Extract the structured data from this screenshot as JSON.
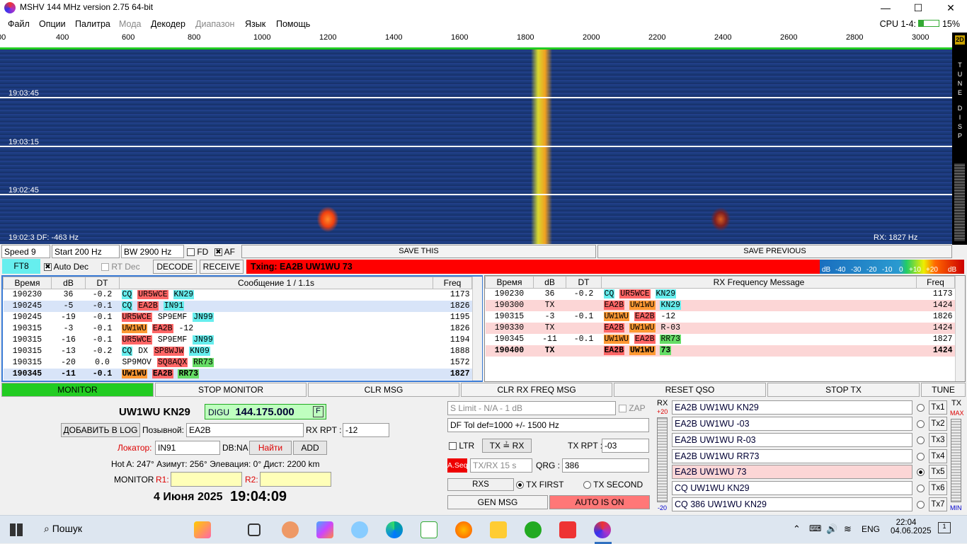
{
  "window": {
    "title": "MSHV 144 MHz version 2.75 64-bit",
    "min": "—",
    "max": "☐",
    "close": "✕"
  },
  "menu": [
    "Файл",
    "Опции",
    "Палитра",
    "Мода",
    "Декодер",
    "Диапазон",
    "Язык",
    "Помощь"
  ],
  "menu_disabled": [
    false,
    false,
    false,
    true,
    false,
    true,
    false,
    false
  ],
  "cpu": {
    "label": "CPU 1-4:",
    "value": "15%"
  },
  "ruler": [
    "00",
    "400",
    "600",
    "800",
    "1000",
    "1200",
    "1400",
    "1600",
    "1800",
    "2000",
    "2200",
    "2400",
    "2600",
    "2800",
    "3000"
  ],
  "waterfall": {
    "times": [
      "19:03:45",
      "19:03:15",
      "19:02:45",
      "19:02:3"
    ],
    "df": "DF: -463 Hz",
    "rx": "RX: 1827 Hz",
    "side": [
      "2D",
      "T",
      "U",
      "N",
      "E",
      "D",
      "I",
      "S",
      "P"
    ]
  },
  "toolbar": {
    "speed": "Speed 9",
    "start": "Start 200 Hz",
    "bw": "BW 2900 Hz",
    "fd": "FD",
    "af": "AF",
    "save_this": "SAVE THIS",
    "save_prev": "SAVE PREVIOUS"
  },
  "mode": {
    "ft8": "FT8",
    "auto_dec": "Auto Dec",
    "rt_dec": "RT Dec",
    "decode": "DECODE",
    "receive": "RECEIVE",
    "txing": "Txing: EA2B UW1WU 73"
  },
  "dbmeter": [
    "dB",
    "-40",
    "-30",
    "-20",
    "-10",
    "0",
    "+10",
    "+20",
    "dB"
  ],
  "left_table": {
    "headers": [
      "Время",
      "dB",
      "DT",
      "Сообщение 1 / 1.1s",
      "Freq"
    ],
    "rows": [
      {
        "t": "190230",
        "db": "36",
        "dt": "-0.2",
        "parts": [
          [
            "CQ",
            "cq"
          ],
          [
            "UR5WCE",
            "red"
          ],
          [
            "KN29",
            "loc"
          ]
        ],
        "f": "1173",
        "cls": ""
      },
      {
        "t": "190245",
        "db": "-5",
        "dt": "-0.1",
        "parts": [
          [
            "CQ",
            "cq"
          ],
          [
            "EA2B",
            "red"
          ],
          [
            "IN91",
            "loc"
          ]
        ],
        "f": "1826",
        "cls": "rowsel"
      },
      {
        "t": "190245",
        "db": "-19",
        "dt": "-0.1",
        "parts": [
          [
            "UR5WCE",
            "red"
          ],
          [
            "SP9EMF",
            ""
          ],
          [
            "JN99",
            "loc"
          ]
        ],
        "f": "1195",
        "cls": ""
      },
      {
        "t": "190315",
        "db": "-3",
        "dt": "-0.1",
        "parts": [
          [
            "UW1WU",
            "me"
          ],
          [
            "EA2B",
            "red"
          ],
          [
            "-12",
            ""
          ]
        ],
        "f": "1826",
        "cls": ""
      },
      {
        "t": "190315",
        "db": "-16",
        "dt": "-0.1",
        "parts": [
          [
            "UR5WCE",
            "red"
          ],
          [
            "SP9EMF",
            ""
          ],
          [
            "JN99",
            "loc"
          ]
        ],
        "f": "1194",
        "cls": ""
      },
      {
        "t": "190315",
        "db": "-13",
        "dt": "-0.2",
        "parts": [
          [
            "CQ",
            "cq"
          ],
          [
            "DX",
            ""
          ],
          [
            "SP8WJW",
            "red"
          ],
          [
            "KN09",
            "loc"
          ]
        ],
        "f": "1888",
        "cls": ""
      },
      {
        "t": "190315",
        "db": "-20",
        "dt": "0.0",
        "parts": [
          [
            "SP9MOV",
            ""
          ],
          [
            "SQ8AQX",
            "red"
          ],
          [
            "RR73",
            "rr"
          ]
        ],
        "f": "1572",
        "cls": ""
      },
      {
        "t": "190345",
        "db": "-11",
        "dt": "-0.1",
        "parts": [
          [
            "UW1WU",
            "me"
          ],
          [
            "EA2B",
            "red"
          ],
          [
            "RR73",
            "rr"
          ]
        ],
        "f": "1827",
        "cls": "rowsel"
      }
    ]
  },
  "right_table": {
    "headers": [
      "Время",
      "dB",
      "DT",
      "RX Frequency Message",
      "Freq"
    ],
    "rows": [
      {
        "t": "190230",
        "db": "36",
        "dt": "-0.2",
        "parts": [
          [
            "CQ",
            "cq"
          ],
          [
            "UR5WCE",
            "red"
          ],
          [
            "KN29",
            "loc"
          ]
        ],
        "f": "1173",
        "cls": ""
      },
      {
        "t": "190300",
        "db": "TX",
        "dt": "",
        "parts": [
          [
            "EA2B",
            "red"
          ],
          [
            "UW1WU",
            "me"
          ],
          [
            "KN29",
            "loc"
          ]
        ],
        "f": "1424",
        "cls": "rowtx"
      },
      {
        "t": "190315",
        "db": "-3",
        "dt": "-0.1",
        "parts": [
          [
            "UW1WU",
            "me"
          ],
          [
            "EA2B",
            "red"
          ],
          [
            "-12",
            ""
          ]
        ],
        "f": "1826",
        "cls": ""
      },
      {
        "t": "190330",
        "db": "TX",
        "dt": "",
        "parts": [
          [
            "EA2B",
            "red"
          ],
          [
            "UW1WU",
            "me"
          ],
          [
            "R-03",
            ""
          ]
        ],
        "f": "1424",
        "cls": "rowtx"
      },
      {
        "t": "190345",
        "db": "-11",
        "dt": "-0.1",
        "parts": [
          [
            "UW1WU",
            "me"
          ],
          [
            "EA2B",
            "red"
          ],
          [
            "RR73",
            "rr"
          ]
        ],
        "f": "1827",
        "cls": ""
      },
      {
        "t": "190400",
        "db": "TX",
        "dt": "",
        "parts": [
          [
            "EA2B",
            "red"
          ],
          [
            "UW1WU",
            "me"
          ],
          [
            "73",
            "rr"
          ]
        ],
        "f": "1424",
        "cls": "rowtx"
      }
    ]
  },
  "buttons": [
    "MONITOR",
    "STOP MONITOR",
    "CLR MSG",
    "CLR RX FREQ MSG",
    "RESET QSO",
    "STOP TX",
    "TUNE"
  ],
  "station": {
    "call": "UW1WU KN29",
    "mode": "DIGU",
    "freq": "144.175.000",
    "f": "F",
    "add_log": "ДОБАВИТЬ В LOG",
    "callsign_lbl": "Позывной:",
    "callsign": "EA2B",
    "rxrpt_lbl": "RX RPT :",
    "rxrpt": "-12",
    "loc_lbl": "Локатор:",
    "loc": "IN91",
    "db": "DB:NA",
    "find": "Найти",
    "add": "ADD",
    "info": "Hot A: 247°   Азимут: 256°   Элевация: 0°   Дист: 2200 km",
    "monitor": "MONITOR",
    "r1": "R1:",
    "r2": "R2:",
    "date": "4 Июня 2025",
    "time": "19:04:09"
  },
  "mid": {
    "slimit": "S Limit - N/A - 1  dB",
    "zap": "ZAP",
    "dftol": "DF Tol def=1000 +/-  1500  Hz",
    "ltr": "LTR",
    "txrx": "TX ≟ RX",
    "txrpt_lbl": "TX RPT :",
    "txrpt": "-03",
    "aseq": "A.Seq",
    "txrx15": "TX/RX 15  s",
    "qrg_lbl": "QRG :",
    "qrg": "386",
    "rxs": "RXS",
    "txfirst": "TX FIRST",
    "txsecond": "TX SECOND",
    "genmsg": "GEN MSG",
    "auto": "AUTO IS ON"
  },
  "tx": {
    "rx": "RX",
    "tx": "TX",
    "p20": "+20",
    "m20": "-20",
    "max": "MAX",
    "min": "MIN",
    "msgs": [
      "EA2B UW1WU KN29",
      "EA2B UW1WU -03",
      "EA2B UW1WU R-03",
      "EA2B UW1WU RR73",
      "EA2B UW1WU 73",
      "CQ UW1WU KN29",
      "CQ 386 UW1WU KN29"
    ],
    "btns": [
      "Tx1",
      "Tx2",
      "Tx3",
      "Tx4",
      "Tx5",
      "Tx6",
      "Tx7"
    ]
  },
  "taskbar": {
    "search": "Пошук",
    "lang": "ENG",
    "time": "22:04",
    "date": "04.06.2025",
    "notif": "1"
  }
}
